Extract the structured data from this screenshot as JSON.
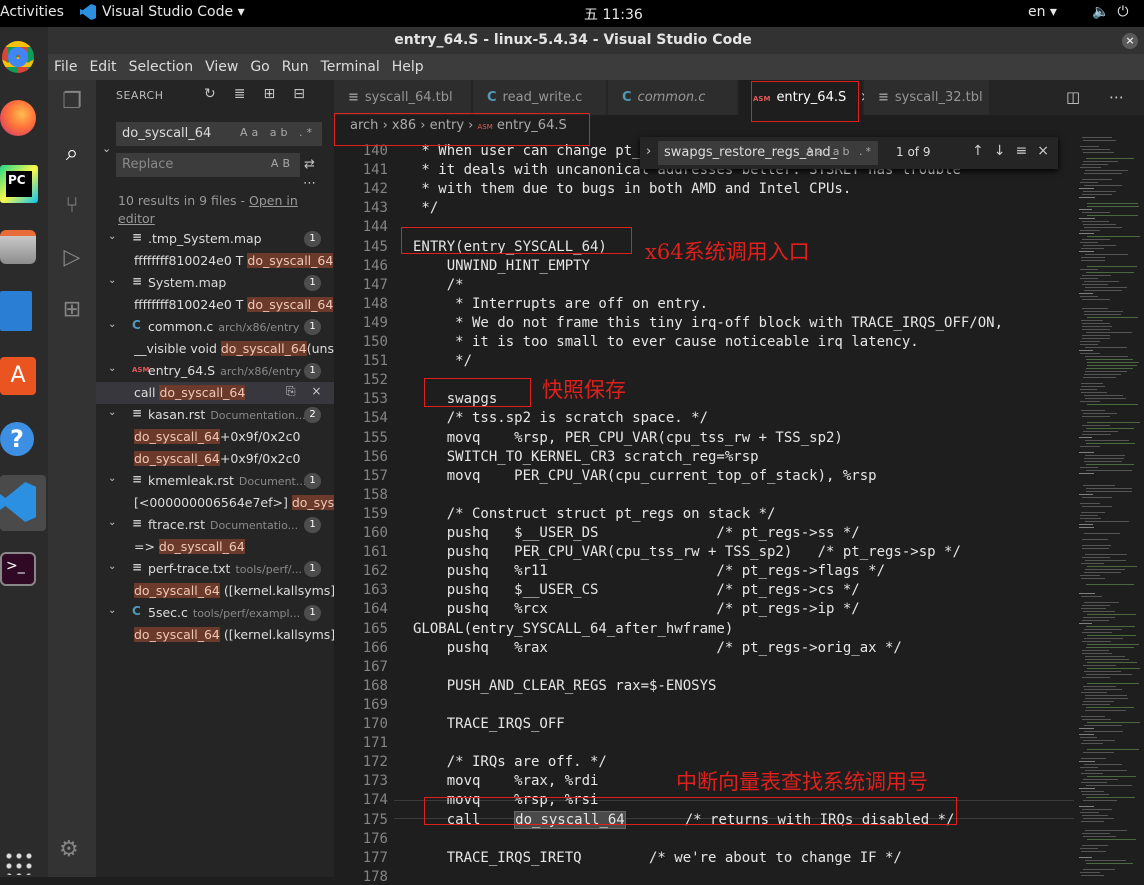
{
  "topbar": {
    "activities": "Activities",
    "app": "Visual Studio Code ▾",
    "clock": "五 11:36",
    "lang": "en ▾",
    "sys_icons": "🔈⏻"
  },
  "window": {
    "title": "entry_64.S - linux-5.4.34 - Visual Studio Code",
    "close": "×"
  },
  "menu": [
    "File",
    "Edit",
    "Selection",
    "View",
    "Go",
    "Run",
    "Terminal",
    "Help"
  ],
  "activity_icons": [
    "explorer-icon",
    "search-icon",
    "source-control-icon",
    "debug-icon",
    "extensions-icon"
  ],
  "sidebar": {
    "header": "SEARCH",
    "header_icons": "↻≣⊞⊟",
    "search_value": "do_syscall_64",
    "search_opts": "Aa ab .*",
    "replace_placeholder": "Replace",
    "replace_opt": "AB",
    "results_text": "10 results in 9 files - ",
    "open_in_editor": "Open in editor",
    "more": "⋯",
    "tree": [
      {
        "type": "file",
        "icon": "≡",
        "name": ".tmp_System.map",
        "dir": "",
        "count": "1"
      },
      {
        "type": "match",
        "pre": "ffffffff810024e0 T ",
        "hit": "do_syscall_64",
        "post": ""
      },
      {
        "type": "file",
        "icon": "≡",
        "name": "System.map",
        "dir": "",
        "count": "1"
      },
      {
        "type": "match",
        "pre": "ffffffff810024e0 T ",
        "hit": "do_syscall_64",
        "post": ""
      },
      {
        "type": "file",
        "icon": "C",
        "name": "common.c",
        "dir": "arch/x86/entry",
        "count": "1"
      },
      {
        "type": "match",
        "pre": "__visible void ",
        "hit": "do_syscall_64",
        "post": "(uns..."
      },
      {
        "type": "file",
        "icon": "ASM",
        "name": "entry_64.S",
        "dir": "arch/x86/entry",
        "count": "1"
      },
      {
        "type": "match",
        "pre": "call ",
        "hit": "do_syscall_64",
        "post": "",
        "selected": true
      },
      {
        "type": "file",
        "icon": "≡",
        "name": "kasan.rst",
        "dir": "Documentation...",
        "count": "2"
      },
      {
        "type": "match",
        "pre": "",
        "hit": "do_syscall_64",
        "post": "+0x9f/0x2c0"
      },
      {
        "type": "match",
        "pre": "",
        "hit": "do_syscall_64",
        "post": "+0x9f/0x2c0"
      },
      {
        "type": "file",
        "icon": "≡",
        "name": "kmemleak.rst",
        "dir": "Document...",
        "count": "1"
      },
      {
        "type": "match",
        "pre": "[<000000006564e7ef>] ",
        "hit": "do_sysc...",
        "post": ""
      },
      {
        "type": "file",
        "icon": "≡",
        "name": "ftrace.rst",
        "dir": "Documentatio...",
        "count": "1"
      },
      {
        "type": "match",
        "pre": "=> ",
        "hit": "do_syscall_64",
        "post": ""
      },
      {
        "type": "file",
        "icon": "≡",
        "name": "perf-trace.txt",
        "dir": "tools/perf/...",
        "count": "1"
      },
      {
        "type": "match",
        "pre": "",
        "hit": "do_syscall_64",
        "post": " ([kernel.kallsyms])"
      },
      {
        "type": "file",
        "icon": "C",
        "name": "5sec.c",
        "dir": "tools/perf/exampl...",
        "count": "1"
      },
      {
        "type": "match",
        "pre": "",
        "hit": "do_syscall_64",
        "post": " ([kernel.kallsyms])"
      }
    ],
    "row_actions": "⎘ ×"
  },
  "tabs": [
    {
      "icon": "≡",
      "label": "syscall_64.tbl",
      "active": false,
      "italic": false
    },
    {
      "icon": "C",
      "label": "read_write.c",
      "active": false,
      "italic": false
    },
    {
      "icon": "C",
      "label": "common.c",
      "active": false,
      "italic": true
    },
    {
      "icon": "ASM",
      "label": "entry_64.S",
      "active": true,
      "italic": false,
      "close": "×"
    },
    {
      "icon": "≡",
      "label": "syscall_32.tbl",
      "active": false,
      "italic": false
    }
  ],
  "editor_actions": "◫ ⋯",
  "breadcrumb": [
    "arch",
    "x86",
    "entry",
    "entry_64.S"
  ],
  "find": {
    "value": "swapgs_restore_regs_and_",
    "opts": "Aa ab .*",
    "count": "1 of 9",
    "buttons": "↑↓≡×",
    "chev": "›"
  },
  "code_lines": [
    {
      "n": "140",
      "t": " * When user can change pt_regs->foo always force IRET. That is because"
    },
    {
      "n": "141",
      "t": " * it deals with uncanonical addresses better. SYSRET has trouble"
    },
    {
      "n": "142",
      "t": " * with them due to bugs in both AMD and Intel CPUs."
    },
    {
      "n": "143",
      "t": " */"
    },
    {
      "n": "144",
      "t": ""
    },
    {
      "n": "145",
      "t": "ENTRY(entry_SYSCALL_64)"
    },
    {
      "n": "146",
      "t": "    UNWIND_HINT_EMPTY"
    },
    {
      "n": "147",
      "t": "    /*"
    },
    {
      "n": "148",
      "t": "     * Interrupts are off on entry."
    },
    {
      "n": "149",
      "t": "     * We do not frame this tiny irq-off block with TRACE_IRQS_OFF/ON,"
    },
    {
      "n": "150",
      "t": "     * it is too small to ever cause noticeable irq latency."
    },
    {
      "n": "151",
      "t": "     */"
    },
    {
      "n": "152",
      "t": ""
    },
    {
      "n": "153",
      "t": "    swapgs"
    },
    {
      "n": "154",
      "t": "    /* tss.sp2 is scratch space. */"
    },
    {
      "n": "155",
      "t": "    movq    %rsp, PER_CPU_VAR(cpu_tss_rw + TSS_sp2)"
    },
    {
      "n": "156",
      "t": "    SWITCH_TO_KERNEL_CR3 scratch_reg=%rsp"
    },
    {
      "n": "157",
      "t": "    movq    PER_CPU_VAR(cpu_current_top_of_stack), %rsp"
    },
    {
      "n": "158",
      "t": ""
    },
    {
      "n": "159",
      "t": "    /* Construct struct pt_regs on stack */"
    },
    {
      "n": "160",
      "t": "    pushq   $__USER_DS              /* pt_regs->ss */"
    },
    {
      "n": "161",
      "t": "    pushq   PER_CPU_VAR(cpu_tss_rw + TSS_sp2)   /* pt_regs->sp */"
    },
    {
      "n": "162",
      "t": "    pushq   %r11                    /* pt_regs->flags */"
    },
    {
      "n": "163",
      "t": "    pushq   $__USER_CS              /* pt_regs->cs */"
    },
    {
      "n": "164",
      "t": "    pushq   %rcx                    /* pt_regs->ip */"
    },
    {
      "n": "165",
      "t": "GLOBAL(entry_SYSCALL_64_after_hwframe)"
    },
    {
      "n": "166",
      "t": "    pushq   %rax                    /* pt_regs->orig_ax */"
    },
    {
      "n": "167",
      "t": ""
    },
    {
      "n": "168",
      "t": "    PUSH_AND_CLEAR_REGS rax=$-ENOSYS"
    },
    {
      "n": "169",
      "t": ""
    },
    {
      "n": "170",
      "t": "    TRACE_IRQS_OFF"
    },
    {
      "n": "171",
      "t": ""
    },
    {
      "n": "172",
      "t": "    /* IRQs are off. */"
    },
    {
      "n": "173",
      "t": "    movq    %rax, %rdi"
    },
    {
      "n": "174",
      "t": "    movq    %rsp, %rsi"
    },
    {
      "n": "175",
      "pre": "    call    ",
      "hit": "do_syscall_64",
      "post": "       /* returns with IRQs disabled */"
    },
    {
      "n": "176",
      "t": ""
    },
    {
      "n": "177",
      "t": "    TRACE_IRQS_IRETQ        /* we're about to change IF */"
    },
    {
      "n": "178",
      "t": ""
    }
  ],
  "annotations": {
    "entry": "x64系统调用入口",
    "swapgs": "快照保存",
    "call": "中断向量表查找系统调用号"
  },
  "colors": {
    "annotation": "#e0201c",
    "accent": "#007acc",
    "match_highlight": "#6b3a2a"
  }
}
